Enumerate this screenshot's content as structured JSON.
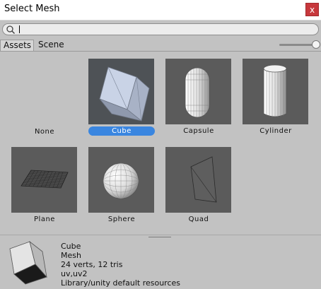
{
  "window": {
    "title": "Select Mesh",
    "close_label": "x"
  },
  "search": {
    "value": "",
    "placeholder": ""
  },
  "tabs": [
    {
      "label": "Assets"
    },
    {
      "label": "Scene"
    }
  ],
  "items": [
    {
      "name": "None"
    },
    {
      "name": "Cube",
      "selected": true
    },
    {
      "name": "Capsule"
    },
    {
      "name": "Cylinder"
    },
    {
      "name": "Plane"
    },
    {
      "name": "Sphere"
    },
    {
      "name": "Quad"
    }
  ],
  "details": {
    "name": "Cube",
    "type": "Mesh",
    "stats": "24 verts, 12 tris",
    "channels": "uv,uv2",
    "path": "Library/unity default resources"
  },
  "colors": {
    "selection": "#3a86e0",
    "close": "#c7383c",
    "thumb_bg": "#5b5b5b"
  },
  "icons": {
    "search": "magnifier-icon",
    "close": "close-icon"
  }
}
